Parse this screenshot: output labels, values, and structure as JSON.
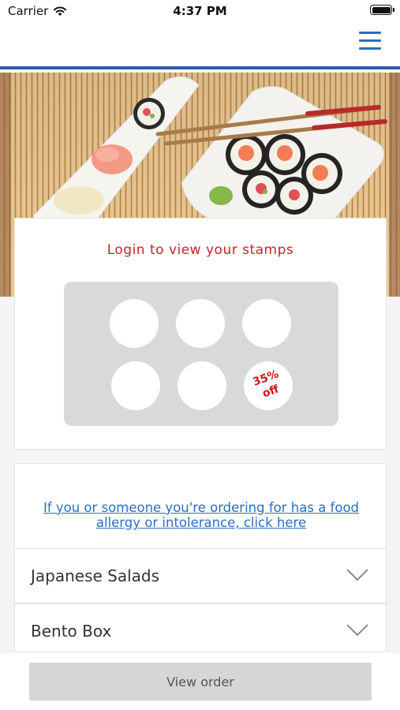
{
  "status_bar": {
    "carrier": "Carrier",
    "time": "4:37 PM"
  },
  "nav": {
    "menu_icon": "hamburger-menu-icon",
    "accent_color": "#2a5ea8"
  },
  "hero": {
    "image": "sushi-platter-photo"
  },
  "stamps": {
    "title": "Login to view your stamps",
    "total": 6,
    "reward_line1": "35%",
    "reward_line2": "off"
  },
  "allergy": {
    "link_text": "If you or someone you're ordering for has a food allergy or intolerance, click here"
  },
  "categories": [
    {
      "label": "Japanese Salads",
      "icon": "chevron-down-icon"
    },
    {
      "label": "Bento Box",
      "icon": "chevron-down-icon"
    }
  ],
  "footer": {
    "view_order_label": "View order"
  },
  "colors": {
    "title_red": "#c8232a",
    "link_blue": "#2a6fc0",
    "button_grey": "#d6d6d6"
  }
}
